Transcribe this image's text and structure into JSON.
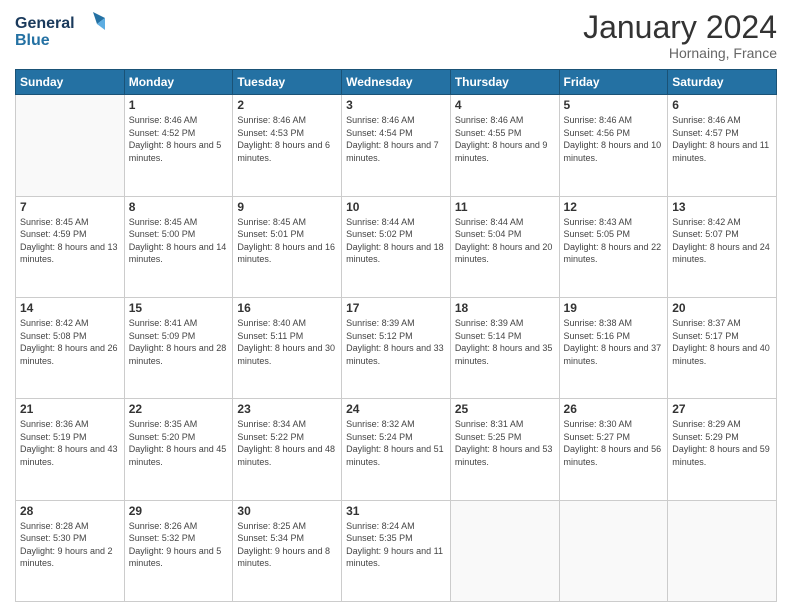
{
  "header": {
    "logo_line1": "General",
    "logo_line2": "Blue",
    "month": "January 2024",
    "location": "Hornaing, France"
  },
  "days_of_week": [
    "Sunday",
    "Monday",
    "Tuesday",
    "Wednesday",
    "Thursday",
    "Friday",
    "Saturday"
  ],
  "weeks": [
    [
      {
        "day": "",
        "sunrise": "",
        "sunset": "",
        "daylight": ""
      },
      {
        "day": "1",
        "sunrise": "Sunrise: 8:46 AM",
        "sunset": "Sunset: 4:52 PM",
        "daylight": "Daylight: 8 hours and 5 minutes."
      },
      {
        "day": "2",
        "sunrise": "Sunrise: 8:46 AM",
        "sunset": "Sunset: 4:53 PM",
        "daylight": "Daylight: 8 hours and 6 minutes."
      },
      {
        "day": "3",
        "sunrise": "Sunrise: 8:46 AM",
        "sunset": "Sunset: 4:54 PM",
        "daylight": "Daylight: 8 hours and 7 minutes."
      },
      {
        "day": "4",
        "sunrise": "Sunrise: 8:46 AM",
        "sunset": "Sunset: 4:55 PM",
        "daylight": "Daylight: 8 hours and 9 minutes."
      },
      {
        "day": "5",
        "sunrise": "Sunrise: 8:46 AM",
        "sunset": "Sunset: 4:56 PM",
        "daylight": "Daylight: 8 hours and 10 minutes."
      },
      {
        "day": "6",
        "sunrise": "Sunrise: 8:46 AM",
        "sunset": "Sunset: 4:57 PM",
        "daylight": "Daylight: 8 hours and 11 minutes."
      }
    ],
    [
      {
        "day": "7",
        "sunrise": "Sunrise: 8:45 AM",
        "sunset": "Sunset: 4:59 PM",
        "daylight": "Daylight: 8 hours and 13 minutes."
      },
      {
        "day": "8",
        "sunrise": "Sunrise: 8:45 AM",
        "sunset": "Sunset: 5:00 PM",
        "daylight": "Daylight: 8 hours and 14 minutes."
      },
      {
        "day": "9",
        "sunrise": "Sunrise: 8:45 AM",
        "sunset": "Sunset: 5:01 PM",
        "daylight": "Daylight: 8 hours and 16 minutes."
      },
      {
        "day": "10",
        "sunrise": "Sunrise: 8:44 AM",
        "sunset": "Sunset: 5:02 PM",
        "daylight": "Daylight: 8 hours and 18 minutes."
      },
      {
        "day": "11",
        "sunrise": "Sunrise: 8:44 AM",
        "sunset": "Sunset: 5:04 PM",
        "daylight": "Daylight: 8 hours and 20 minutes."
      },
      {
        "day": "12",
        "sunrise": "Sunrise: 8:43 AM",
        "sunset": "Sunset: 5:05 PM",
        "daylight": "Daylight: 8 hours and 22 minutes."
      },
      {
        "day": "13",
        "sunrise": "Sunrise: 8:42 AM",
        "sunset": "Sunset: 5:07 PM",
        "daylight": "Daylight: 8 hours and 24 minutes."
      }
    ],
    [
      {
        "day": "14",
        "sunrise": "Sunrise: 8:42 AM",
        "sunset": "Sunset: 5:08 PM",
        "daylight": "Daylight: 8 hours and 26 minutes."
      },
      {
        "day": "15",
        "sunrise": "Sunrise: 8:41 AM",
        "sunset": "Sunset: 5:09 PM",
        "daylight": "Daylight: 8 hours and 28 minutes."
      },
      {
        "day": "16",
        "sunrise": "Sunrise: 8:40 AM",
        "sunset": "Sunset: 5:11 PM",
        "daylight": "Daylight: 8 hours and 30 minutes."
      },
      {
        "day": "17",
        "sunrise": "Sunrise: 8:39 AM",
        "sunset": "Sunset: 5:12 PM",
        "daylight": "Daylight: 8 hours and 33 minutes."
      },
      {
        "day": "18",
        "sunrise": "Sunrise: 8:39 AM",
        "sunset": "Sunset: 5:14 PM",
        "daylight": "Daylight: 8 hours and 35 minutes."
      },
      {
        "day": "19",
        "sunrise": "Sunrise: 8:38 AM",
        "sunset": "Sunset: 5:16 PM",
        "daylight": "Daylight: 8 hours and 37 minutes."
      },
      {
        "day": "20",
        "sunrise": "Sunrise: 8:37 AM",
        "sunset": "Sunset: 5:17 PM",
        "daylight": "Daylight: 8 hours and 40 minutes."
      }
    ],
    [
      {
        "day": "21",
        "sunrise": "Sunrise: 8:36 AM",
        "sunset": "Sunset: 5:19 PM",
        "daylight": "Daylight: 8 hours and 43 minutes."
      },
      {
        "day": "22",
        "sunrise": "Sunrise: 8:35 AM",
        "sunset": "Sunset: 5:20 PM",
        "daylight": "Daylight: 8 hours and 45 minutes."
      },
      {
        "day": "23",
        "sunrise": "Sunrise: 8:34 AM",
        "sunset": "Sunset: 5:22 PM",
        "daylight": "Daylight: 8 hours and 48 minutes."
      },
      {
        "day": "24",
        "sunrise": "Sunrise: 8:32 AM",
        "sunset": "Sunset: 5:24 PM",
        "daylight": "Daylight: 8 hours and 51 minutes."
      },
      {
        "day": "25",
        "sunrise": "Sunrise: 8:31 AM",
        "sunset": "Sunset: 5:25 PM",
        "daylight": "Daylight: 8 hours and 53 minutes."
      },
      {
        "day": "26",
        "sunrise": "Sunrise: 8:30 AM",
        "sunset": "Sunset: 5:27 PM",
        "daylight": "Daylight: 8 hours and 56 minutes."
      },
      {
        "day": "27",
        "sunrise": "Sunrise: 8:29 AM",
        "sunset": "Sunset: 5:29 PM",
        "daylight": "Daylight: 8 hours and 59 minutes."
      }
    ],
    [
      {
        "day": "28",
        "sunrise": "Sunrise: 8:28 AM",
        "sunset": "Sunset: 5:30 PM",
        "daylight": "Daylight: 9 hours and 2 minutes."
      },
      {
        "day": "29",
        "sunrise": "Sunrise: 8:26 AM",
        "sunset": "Sunset: 5:32 PM",
        "daylight": "Daylight: 9 hours and 5 minutes."
      },
      {
        "day": "30",
        "sunrise": "Sunrise: 8:25 AM",
        "sunset": "Sunset: 5:34 PM",
        "daylight": "Daylight: 9 hours and 8 minutes."
      },
      {
        "day": "31",
        "sunrise": "Sunrise: 8:24 AM",
        "sunset": "Sunset: 5:35 PM",
        "daylight": "Daylight: 9 hours and 11 minutes."
      },
      {
        "day": "",
        "sunrise": "",
        "sunset": "",
        "daylight": ""
      },
      {
        "day": "",
        "sunrise": "",
        "sunset": "",
        "daylight": ""
      },
      {
        "day": "",
        "sunrise": "",
        "sunset": "",
        "daylight": ""
      }
    ]
  ]
}
